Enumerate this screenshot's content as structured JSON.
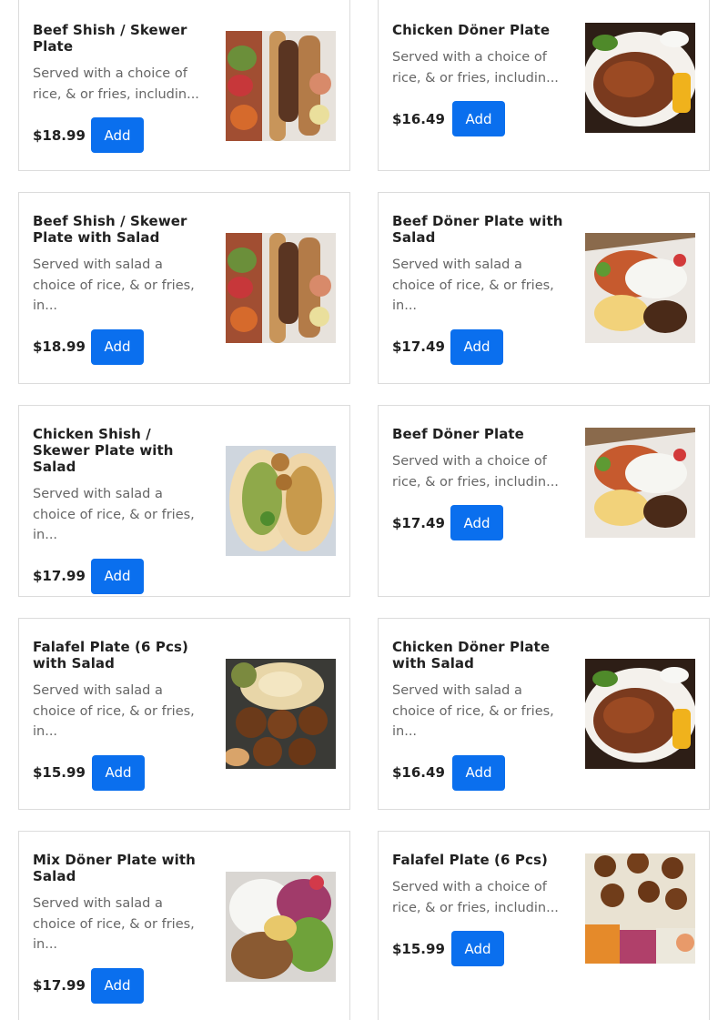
{
  "menu": {
    "add_label": "Add",
    "items": [
      {
        "title": "Beef Shish / Skewer Plate",
        "description": "Served with a choice of rice, & or fries, includin...",
        "price": "$18.99",
        "image": "beef-shish-plate-photo"
      },
      {
        "title": "Chicken Döner Plate",
        "description": "Served with a choice of rice, & or fries, includin...",
        "price": "$16.49",
        "image": "chicken-doner-plate-photo"
      },
      {
        "title": "Beef Shish / Skewer Plate with Salad",
        "description": "Served with salad a choice of rice, & or fries, in...",
        "price": "$18.99",
        "image": "beef-shish-plate-photo"
      },
      {
        "title": "Beef Döner Plate with Salad",
        "description": "Served with salad a choice of rice, & or fries, in...",
        "price": "$17.49",
        "image": "beef-doner-plate-photo"
      },
      {
        "title": "Chicken Shish / Skewer Plate with Salad",
        "description": "Served with salad a choice of rice, & or fries, in...",
        "price": "$17.99",
        "image": "chicken-shish-wrap-photo"
      },
      {
        "title": "Beef Döner Plate",
        "description": "Served with a choice of rice, & or fries, includin...",
        "price": "$17.49",
        "image": "beef-doner-plate-photo"
      },
      {
        "title": "Falafel Plate (6 Pcs) with Salad",
        "description": "Served with salad a choice of rice, & or fries, in...",
        "price": "$15.99",
        "image": "falafel-hummus-photo"
      },
      {
        "title": "Chicken Döner Plate with Salad",
        "description": "Served with salad a choice of rice, & or fries, in...",
        "price": "$16.49",
        "image": "chicken-doner-plate-photo"
      },
      {
        "title": "Mix Döner Plate with Salad",
        "description": "Served with salad a choice of rice, & or fries, in...",
        "price": "$17.99",
        "image": "mix-doner-plate-photo"
      },
      {
        "title": "Falafel Plate (6 Pcs)",
        "description": "Served with a choice of rice, & or fries, includin...",
        "price": "$15.99",
        "image": "falafel-plate-photo"
      }
    ]
  },
  "colors": {
    "button": "#0a6fee",
    "border": "#dcdcdc",
    "title": "#212121",
    "description": "#666666"
  }
}
